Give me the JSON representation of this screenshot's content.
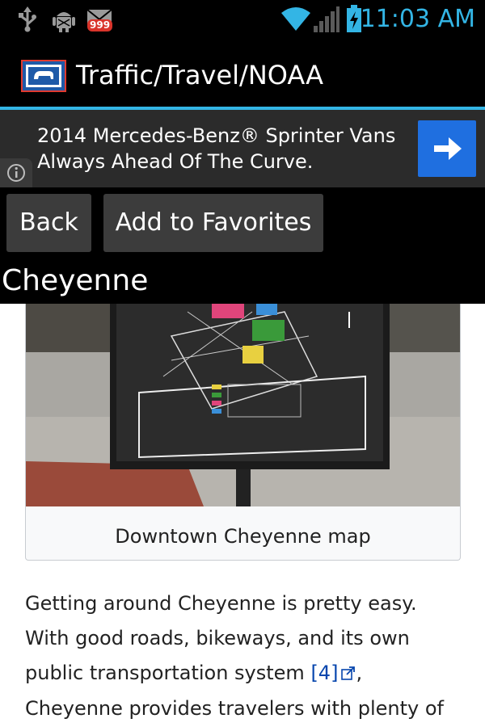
{
  "status_bar": {
    "time": "11:03 AM",
    "notification_count": "999",
    "icons": [
      "usb-icon",
      "android-debug-icon",
      "gmail-icon",
      "wifi-icon",
      "signal-icon",
      "battery-charging-icon"
    ],
    "accent_color": "#33b5e5"
  },
  "action_bar": {
    "title": "Traffic/Travel/NOAA",
    "logo_icon": "wyoming-flag-icon"
  },
  "ad": {
    "text": "2014 Mercedes-Benz® Sprinter Vans Always Ahead Of The Curve.",
    "info_icon": "info-icon",
    "arrow_icon": "arrow-right-icon",
    "button_color": "#1f6fe0"
  },
  "toolbar": {
    "back_label": "Back",
    "favorites_label": "Add to Favorites"
  },
  "page": {
    "title": "Cheyenne",
    "image_caption": "Downtown Cheyenne map",
    "paragraph_before_link": "Getting around Cheyenne is pretty easy. With good roads, bikeways, and its own public transportation system ",
    "reference_link": "[4]",
    "paragraph_after_link": ", Cheyenne provides travelers with plenty of options.",
    "link_color": "#0645ad"
  }
}
